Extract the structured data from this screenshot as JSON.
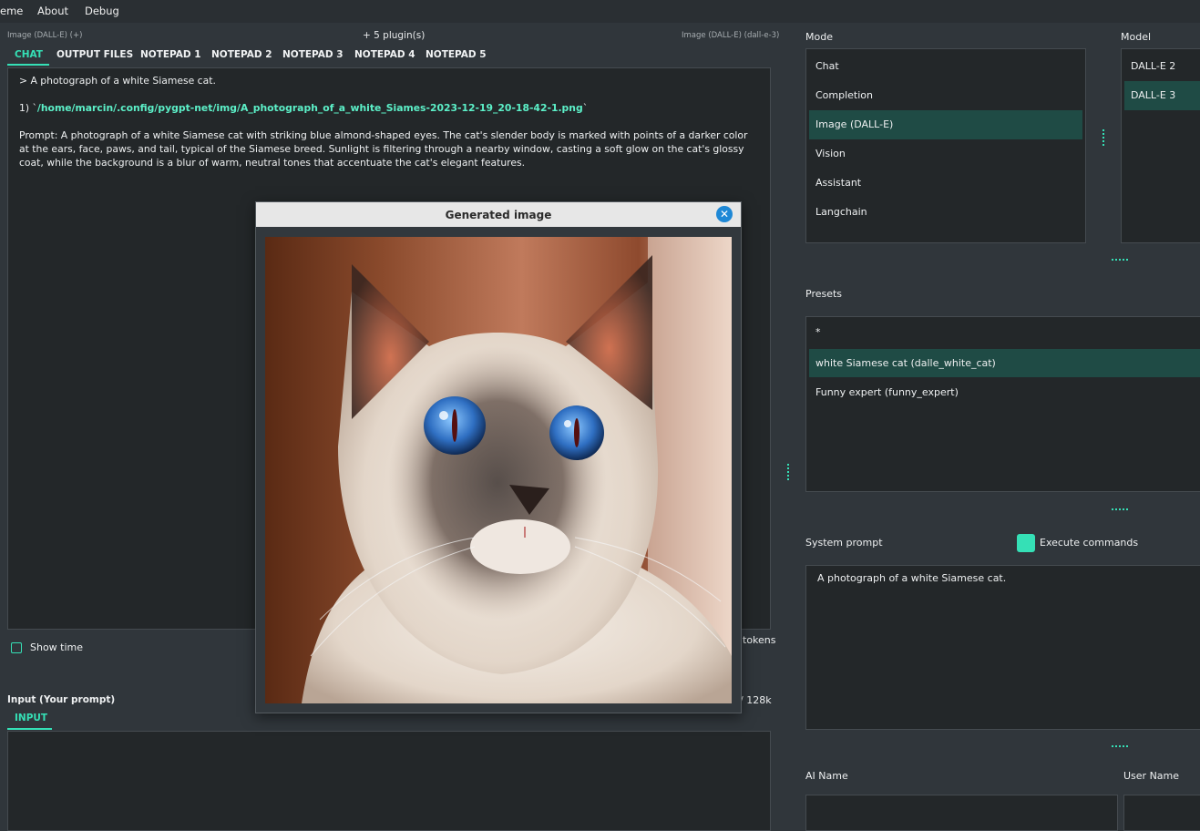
{
  "menubar": {
    "items": [
      "eme",
      "About",
      "Debug"
    ]
  },
  "chat_area": {
    "mode_label": "Image (DALL-E) (+)",
    "plugins_label": "+ 5 plugin(s)",
    "model_label": "Image (DALL-E) (dall-e-3)",
    "tabs": [
      "CHAT",
      "OUTPUT FILES",
      "NOTEPAD 1",
      "NOTEPAD 2",
      "NOTEPAD 3",
      "NOTEPAD 4",
      "NOTEPAD 5"
    ],
    "user_line": "> A photograph of a white Siamese cat.",
    "file_prefix": "1) `",
    "file_path": "/home/marcin/.config/pygpt-net/img/A_photograph_of_a_white_Siames-2023-12-19_20-18-42-1.png",
    "file_suffix": "`",
    "prompt_text": "Prompt: A photograph of a white Siamese cat with striking blue almond-shaped eyes. The cat's slender body is marked with points of a darker color at the ears, face, paws, and tail, typical of the Siamese breed. Sunlight is filtering through a nearby window, casting a soft glow on the cat's glossy coat, while the background is a blur of warm, neutral tones that accentuate the cat's elegant features.",
    "show_time_label": "Show time",
    "tokens_label": "tokens",
    "context_label": "/ 128k"
  },
  "input_area": {
    "label": "Input (Your prompt)",
    "tab": "INPUT"
  },
  "mode_panel": {
    "label": "Mode",
    "items": [
      "Chat",
      "Completion",
      "Image (DALL-E)",
      "Vision",
      "Assistant",
      "Langchain"
    ],
    "selected_index": 2
  },
  "model_panel": {
    "label": "Model",
    "items": [
      "DALL-E 2",
      "DALL-E 3"
    ],
    "selected_index": 1
  },
  "presets_panel": {
    "label": "Presets",
    "items": [
      "*",
      "white Siamese cat (dalle_white_cat)",
      "Funny expert (funny_expert)"
    ],
    "selected_index": 1
  },
  "system_prompt": {
    "label": "System prompt",
    "execute_label": "Execute commands",
    "value": "A photograph of a white Siamese cat."
  },
  "names": {
    "ai_label": "AI Name",
    "user_label": "User Name"
  },
  "dialog": {
    "title": "Generated image",
    "close_icon": "close-icon"
  },
  "colors": {
    "accent": "#35e0b6",
    "selection": "#1f4b45",
    "background": "#30363b",
    "panel": "#232729"
  }
}
